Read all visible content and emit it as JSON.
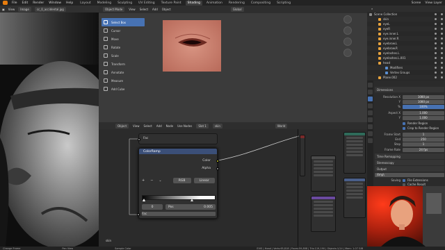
{
  "topbar": {
    "menus": [
      "File",
      "Edit",
      "Render",
      "Window",
      "Help"
    ],
    "workspaces": [
      "Layout",
      "Modeling",
      "Sculpting",
      "UV Editing",
      "Texture Paint",
      "Shading",
      "Animation",
      "Rendering",
      "Compositing",
      "Scripting"
    ],
    "active_workspace": "Shading",
    "scene": "Scene",
    "view_layer": "View Layer"
  },
  "image_editor": {
    "view": "View",
    "mode": "Image",
    "image_name": "cc_0_accidental.jpg"
  },
  "viewport": {
    "mode": "Object Mode",
    "menus": [
      "View",
      "Select",
      "Add",
      "Object"
    ],
    "orientation": "Global",
    "tools": [
      "Select Box",
      "Cursor",
      "Move",
      "Rotate",
      "Scale",
      "Transform",
      "Annotate",
      "Measure",
      "Add Cube"
    ],
    "active_tool": "Select Box"
  },
  "node_editor": {
    "object": "Object",
    "menus": [
      "View",
      "Select",
      "Add",
      "Node"
    ],
    "use_nodes": "Use Nodes",
    "slot": "Slot 1",
    "material": "skin",
    "world_label": "World",
    "fac_top": "Fac",
    "ramp": {
      "title": "ColorRamp",
      "out_color": "Color",
      "out_alpha": "Alpha",
      "add": "+",
      "remove": "−",
      "color_mode": "RGB",
      "interpolation": "Linear",
      "stop_index": "0",
      "pos_label": "Pos",
      "pos_value": "0.005",
      "in_fac": "Fac"
    },
    "bottom_label": "skin"
  },
  "outliner": {
    "header": "Scene Collection",
    "rows": [
      {
        "label": "Scene Collection",
        "color": "#8c8c8c"
      },
      {
        "label": "skin",
        "color": "#e8a33d"
      },
      {
        "label": "eyeL",
        "color": "#e8a33d"
      },
      {
        "label": "eyeR",
        "color": "#e8a33d"
      },
      {
        "label": "eye.inner.L",
        "color": "#e8a33d"
      },
      {
        "label": "eye.inner.R",
        "color": "#e8a33d"
      },
      {
        "label": "eyebrow.L",
        "color": "#e8a33d"
      },
      {
        "label": "eyebrow.R",
        "color": "#e8a33d"
      },
      {
        "label": "eyelashes.L",
        "color": "#e8a33d"
      },
      {
        "label": "eyelashes.L.001",
        "color": "#e8a33d"
      },
      {
        "label": "head",
        "color": "#e8a33d"
      },
      {
        "label": "Modifiers",
        "color": "#5b8fd1"
      },
      {
        "label": "Vertex Groups",
        "color": "#5b8fd1"
      },
      {
        "label": "Plane.002",
        "color": "#e8a33d"
      },
      {
        "label": "skin",
        "color": "#c25050"
      }
    ]
  },
  "properties": {
    "dimensions": "Dimensions",
    "res_x_label": "Resolution X",
    "res_x": "1080 px",
    "res_y_label": "Y",
    "res_y": "1080 px",
    "pct_label": "%",
    "pct": "100%",
    "aspect_x_label": "Aspect X",
    "aspect_x": "1.000",
    "aspect_y_label": "Y",
    "aspect_y": "1.000",
    "render_region": "Render Region",
    "crop": "Crop to Render Region",
    "frame_start_label": "Frame Start",
    "frame_start": "1",
    "frame_end_label": "End",
    "frame_end": "250",
    "frame_step_label": "Step",
    "frame_step": "1",
    "frame_rate_label": "Frame Rate",
    "frame_rate": "24 fps",
    "time_remap": "Time Remapping",
    "stereoscopy": "Stereoscopy",
    "output": "Output",
    "output_path": "/tmp\\",
    "saving_label": "Saving",
    "file_ext": "File Extensions",
    "cache": "Cache Result"
  },
  "statusbar": {
    "left": "Change Frame",
    "mid1": "Pan View",
    "mid2": "Sample Color",
    "stats": "EVIS | Head | Verts:65,818 | Faces:59,808 | Tris:119,190 | Objects:1/14 | Mem: 1.07 GiB"
  }
}
